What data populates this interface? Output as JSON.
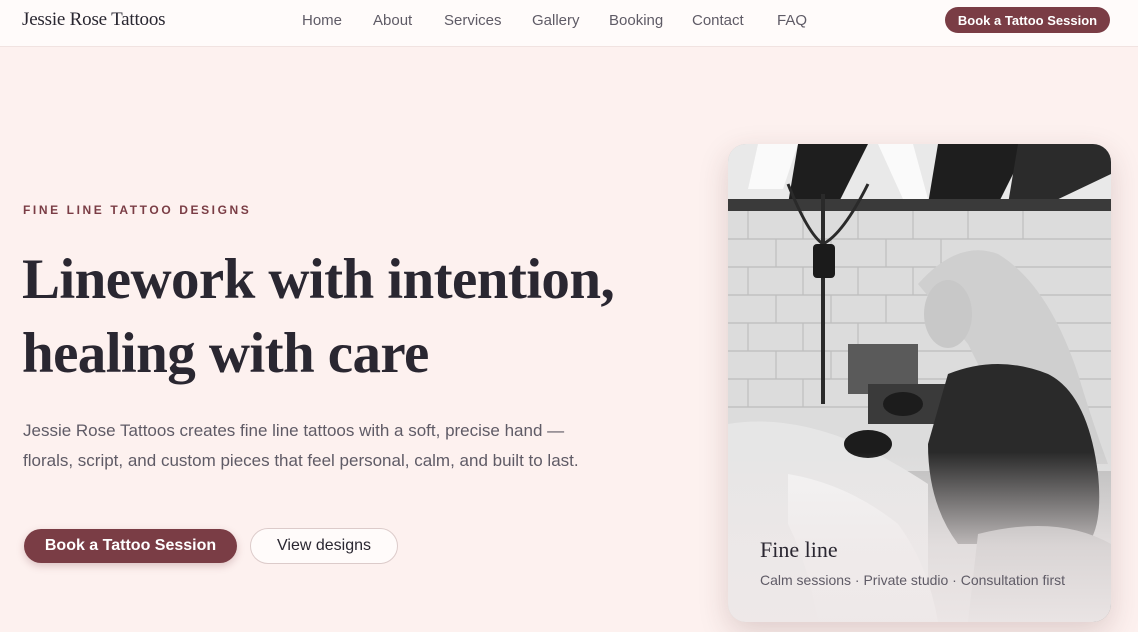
{
  "header": {
    "brand": "Jessie Rose Tattoos",
    "nav": [
      "Home",
      "About",
      "Services",
      "Gallery",
      "Booking",
      "Contact",
      "FAQ"
    ],
    "cta": "Book a Tattoo Session"
  },
  "hero": {
    "eyebrow": "FINE LINE TATTOO DESIGNS",
    "headline_line1": "Linework with intention,",
    "headline_line2": "healing with care",
    "lede": "Jessie Rose Tattoos creates fine line tattoos with a soft, precise hand — florals, script, and custom pieces that feel personal, calm, and built to last.",
    "primary_button": "Book a Tattoo Session",
    "secondary_button": "View designs"
  },
  "card": {
    "image": "tattoo-artist-at-work-photo",
    "title": "Fine line",
    "subtitle": "Calm sessions · Private studio · Consultation first"
  },
  "colors": {
    "background": "#fdf1ef",
    "accent": "#7a3d45",
    "text": "#2a2731",
    "muted": "#5f5b66"
  }
}
